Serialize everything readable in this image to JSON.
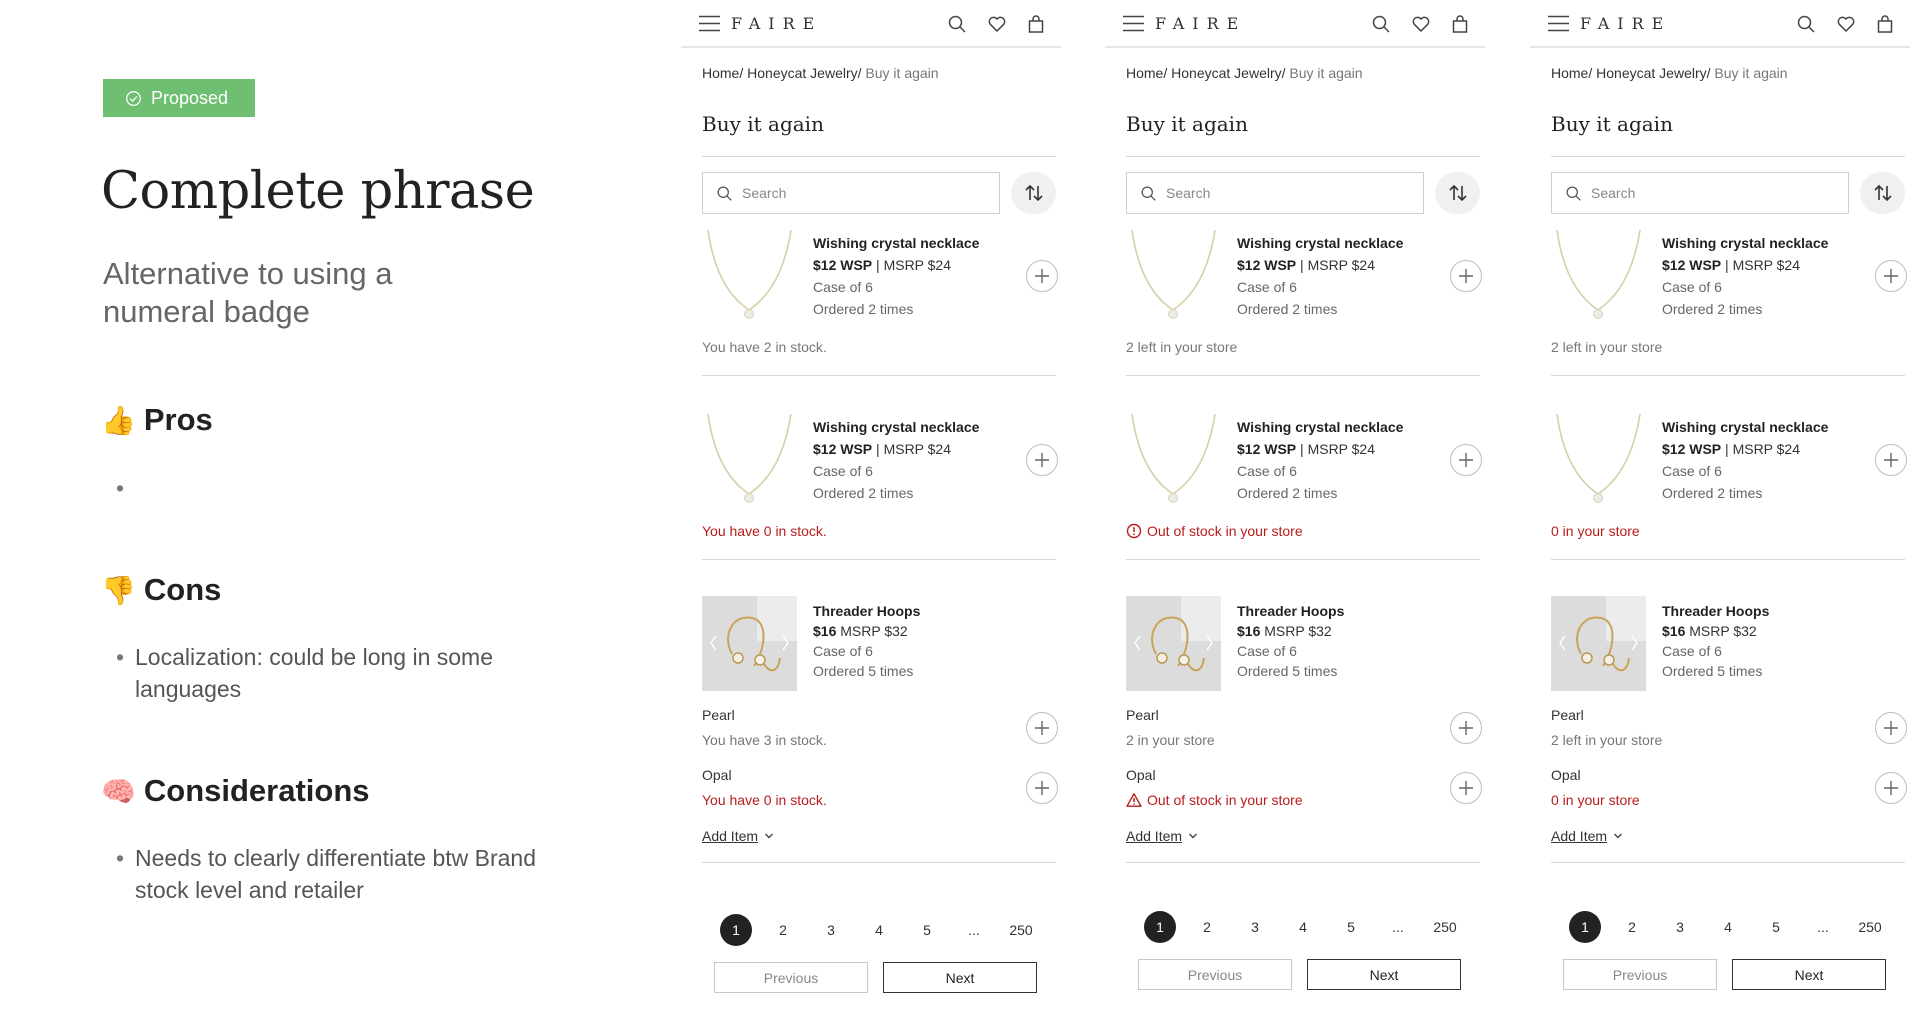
{
  "left": {
    "badge": "Proposed",
    "heading": "Complete phrase",
    "subtitle": "Alternative to using a numeral badge",
    "pros": {
      "emoji": "👍",
      "title": "Pros",
      "items": [
        ""
      ]
    },
    "cons": {
      "emoji": "👎",
      "title": "Cons",
      "items": [
        "Localization: could be long in some languages"
      ]
    },
    "considerations": {
      "emoji": "🧠",
      "title": "Considerations",
      "items": [
        "Needs to clearly differentiate btw Brand stock level and retailer"
      ]
    }
  },
  "colors": {
    "badge": "#6fbf73",
    "alert": "#b81c1c",
    "active_page": "#222222"
  },
  "phones": [
    {
      "logo": "FAIRE",
      "breadcrumb": {
        "home": "Home",
        "brand": "Honeycat Jewelry",
        "current": "Buy it again",
        "sep": "/"
      },
      "title": "Buy it again",
      "search_placeholder": "Search",
      "products": [
        {
          "name": "Wishing crystal necklace",
          "wsp": "$12 WSP",
          "msrp": "MSRP $24",
          "case": "Case of 6",
          "ordered": "Ordered 2 times",
          "stock": "You have 2 in stock.",
          "stock_state": "normal",
          "icon": "none"
        },
        {
          "name": "Wishing crystal necklace",
          "wsp": "$12 WSP",
          "msrp": "MSRP $24",
          "case": "Case of 6",
          "ordered": "Ordered 2 times",
          "stock": "You have 0 in stock.",
          "stock_state": "alert",
          "icon": "none"
        }
      ],
      "hoops": {
        "name": "Threader Hoops",
        "wsp": "$16",
        "msrp": "MSRP $32",
        "case": "Case of 6",
        "ordered": "Ordered 5 times",
        "variants": [
          {
            "label": "Pearl",
            "stock": "You have 3 in stock.",
            "stock_state": "normal",
            "icon": "none"
          },
          {
            "label": "Opal",
            "stock": "You have 0 in stock.",
            "stock_state": "alert",
            "icon": "none"
          }
        ],
        "add_item": "Add Item"
      },
      "pagination": {
        "pages": [
          "1",
          "2",
          "3",
          "4",
          "5",
          "...",
          "250"
        ],
        "active": "1",
        "previous": "Previous",
        "next": "Next"
      }
    },
    {
      "logo": "FAIRE",
      "breadcrumb": {
        "home": "Home",
        "brand": "Honeycat Jewelry",
        "current": "Buy it again",
        "sep": "/"
      },
      "title": "Buy it again",
      "search_placeholder": "Search",
      "products": [
        {
          "name": "Wishing crystal necklace",
          "wsp": "$12 WSP",
          "msrp": "MSRP $24",
          "case": "Case of 6",
          "ordered": "Ordered 2 times",
          "stock": "2 left in your store",
          "stock_state": "normal",
          "icon": "none"
        },
        {
          "name": "Wishing crystal necklace",
          "wsp": "$12 WSP",
          "msrp": "MSRP $24",
          "case": "Case of 6",
          "ordered": "Ordered 2 times",
          "stock": "Out of stock in your store",
          "stock_state": "alert",
          "icon": "alert-circle-icon"
        }
      ],
      "hoops": {
        "name": "Threader Hoops",
        "wsp": "$16",
        "msrp": "MSRP $32",
        "case": "Case of 6",
        "ordered": "Ordered 5 times",
        "variants": [
          {
            "label": "Pearl",
            "stock": "2 in your store",
            "stock_state": "normal",
            "icon": "none"
          },
          {
            "label": "Opal",
            "stock": "Out of stock in your store",
            "stock_state": "alert",
            "icon": "warning-triangle-icon"
          }
        ],
        "add_item": "Add Item"
      },
      "pagination": {
        "pages": [
          "1",
          "2",
          "3",
          "4",
          "5",
          "...",
          "250"
        ],
        "active": "1",
        "previous": "Previous",
        "next": "Next"
      }
    },
    {
      "logo": "FAIRE",
      "breadcrumb": {
        "home": "Home",
        "brand": "Honeycat Jewelry",
        "current": "Buy it again",
        "sep": "/"
      },
      "title": "Buy it again",
      "search_placeholder": "Search",
      "products": [
        {
          "name": "Wishing crystal necklace",
          "wsp": "$12 WSP",
          "msrp": "MSRP $24",
          "case": "Case of 6",
          "ordered": "Ordered 2 times",
          "stock": "2 left in your store",
          "stock_state": "normal",
          "icon": "none"
        },
        {
          "name": "Wishing crystal necklace",
          "wsp": "$12 WSP",
          "msrp": "MSRP $24",
          "case": "Case of 6",
          "ordered": "Ordered 2 times",
          "stock": "0 in your store",
          "stock_state": "alert",
          "icon": "none"
        }
      ],
      "hoops": {
        "name": "Threader Hoops",
        "wsp": "$16",
        "msrp": "MSRP $32",
        "case": "Case of 6",
        "ordered": "Ordered 5 times",
        "variants": [
          {
            "label": "Pearl",
            "stock": "2 left in your store",
            "stock_state": "normal",
            "icon": "none"
          },
          {
            "label": "Opal",
            "stock": "0 in your store",
            "stock_state": "alert",
            "icon": "none"
          }
        ],
        "add_item": "Add Item"
      },
      "pagination": {
        "pages": [
          "1",
          "2",
          "3",
          "4",
          "5",
          "...",
          "250"
        ],
        "active": "1",
        "previous": "Previous",
        "next": "Next"
      }
    }
  ]
}
